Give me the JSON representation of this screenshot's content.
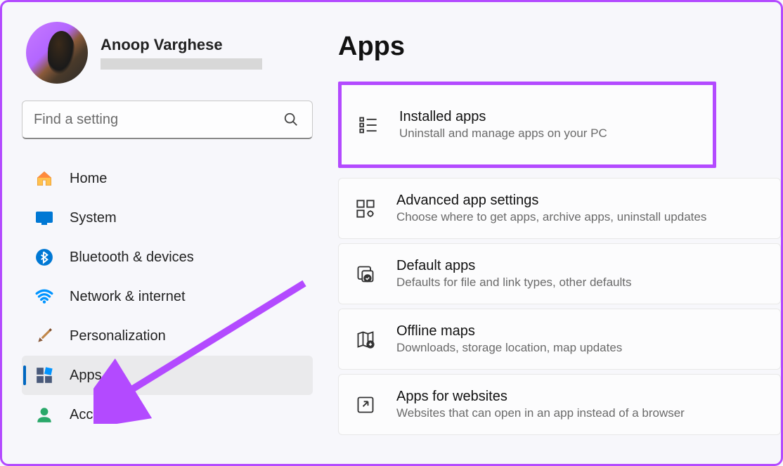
{
  "profile": {
    "name": "Anoop Varghese"
  },
  "search": {
    "placeholder": "Find a setting"
  },
  "nav": {
    "items": [
      {
        "label": "Home"
      },
      {
        "label": "System"
      },
      {
        "label": "Bluetooth & devices"
      },
      {
        "label": "Network & internet"
      },
      {
        "label": "Personalization"
      },
      {
        "label": "Apps"
      },
      {
        "label": "Accounts"
      }
    ]
  },
  "page": {
    "title": "Apps"
  },
  "cards": [
    {
      "title": "Installed apps",
      "desc": "Uninstall and manage apps on your PC"
    },
    {
      "title": "Advanced app settings",
      "desc": "Choose where to get apps, archive apps, uninstall updates"
    },
    {
      "title": "Default apps",
      "desc": "Defaults for file and link types, other defaults"
    },
    {
      "title": "Offline maps",
      "desc": "Downloads, storage location, map updates"
    },
    {
      "title": "Apps for websites",
      "desc": "Websites that can open in an app instead of a browser"
    }
  ]
}
